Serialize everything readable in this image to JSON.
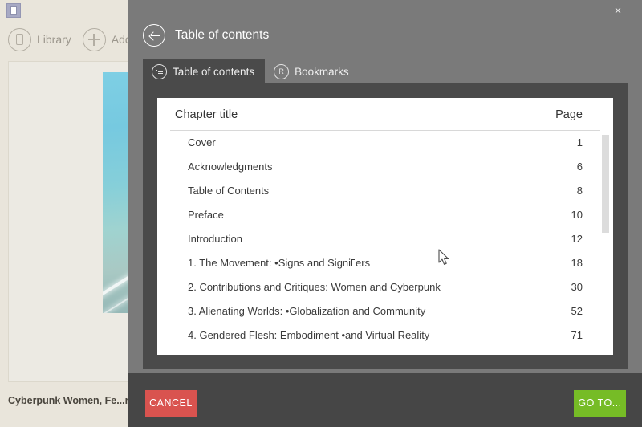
{
  "background_app": {
    "app_icon": "book-app-icon",
    "toolbar": [
      {
        "label": "Library",
        "icon": "book-icon"
      },
      {
        "label": "Add bo",
        "icon": "plus-icon"
      }
    ],
    "book_title": "Cyberpunk Women, Fe...r"
  },
  "modal": {
    "close_label": "×",
    "title": "Table of contents",
    "back_icon": "back-arrow-icon",
    "tabs": [
      {
        "label": "Table of contents",
        "icon": "list-icon",
        "active": true
      },
      {
        "label": "Bookmarks",
        "icon": "bookmark-icon",
        "active": false
      }
    ],
    "list": {
      "columns": {
        "title": "Chapter title",
        "page": "Page"
      },
      "rows": [
        {
          "title": "Cover",
          "page": "1"
        },
        {
          "title": "Acknowledgments",
          "page": "6"
        },
        {
          "title": "Table of Contents",
          "page": "8"
        },
        {
          "title": "Preface",
          "page": "10"
        },
        {
          "title": "Introduction",
          "page": "12"
        },
        {
          "title": "1. The Movement: •Signs and Signi",
          "title_suffix": "ers",
          "page": "18",
          "broken_ligature": true
        },
        {
          "title": "2. Contributions and Critiques: Women and Cyberpunk",
          "page": "30"
        },
        {
          "title": "3. Alienating Worlds: •Globalization and Community",
          "page": "52"
        },
        {
          "title": "4. Gendered Flesh: Embodiment •and Virtual Reality",
          "page": "71"
        }
      ]
    },
    "footer": {
      "cancel_label": "CANCEL",
      "goto_label": "GO TO...",
      "cancel_color": "#d9534f",
      "goto_color": "#76bc26"
    }
  },
  "colors": {
    "modal_bg": "#7a7a7a",
    "panel_bg": "#4a4a4a",
    "footer_bg": "#464646",
    "app_bg": "#e9e5db"
  }
}
